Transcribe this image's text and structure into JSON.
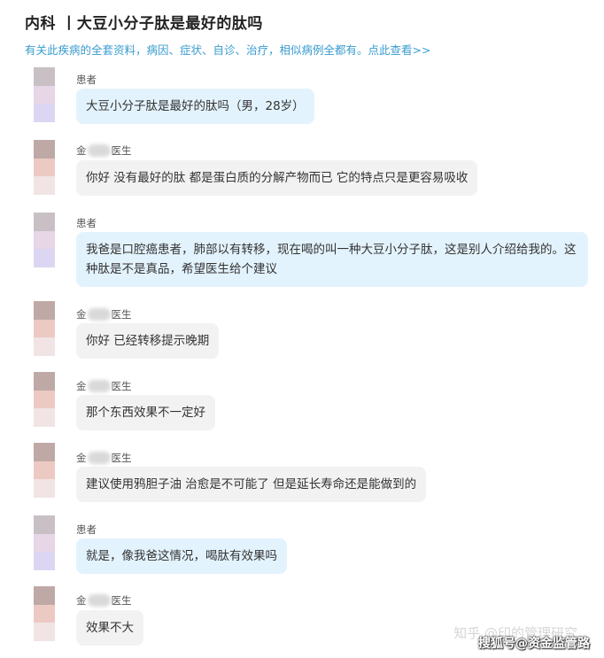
{
  "header": {
    "title": "内科 丨大豆小分子肽是最好的肽吗",
    "subtitle": "有关此疾病的全套资料，病因、症状、自诊、治疗，相似病例全都有。点此查看>>"
  },
  "messages": [
    {
      "role": "patient",
      "sender": "患者",
      "text": "大豆小分子肽是最好的肽吗（男，28岁）"
    },
    {
      "role": "doctor",
      "sender_prefix": "金",
      "sender_suffix": "医生",
      "text": "你好 没有最好的肽 都是蛋白质的分解产物而已 它的特点只是更容易吸收"
    },
    {
      "role": "patient",
      "sender": "患者",
      "text": "我爸是口腔癌患者，肺部以有转移，现在喝的叫一种大豆小分子肽，这是别人介绍给我的。这种肽是不是真品，希望医生给个建议"
    },
    {
      "role": "doctor",
      "sender_prefix": "金",
      "sender_suffix": "医生",
      "text": "你好 已经转移提示晚期"
    },
    {
      "role": "doctor",
      "sender_prefix": "金",
      "sender_suffix": "医生",
      "text": "那个东西效果不一定好"
    },
    {
      "role": "doctor",
      "sender_prefix": "金",
      "sender_suffix": "医生",
      "text": "建议使用鸦胆子油 治愈是不可能了 但是延长寿命还是能做到的"
    },
    {
      "role": "patient",
      "sender": "患者",
      "text": "就是，像我爸这情况，喝肽有效果吗"
    },
    {
      "role": "doctor",
      "sender_prefix": "金",
      "sender_suffix": "医生",
      "text": "效果不大"
    }
  ],
  "watermarks": {
    "zhihu": "知乎 @印的管理研究",
    "sohu": "搜狐号@资金监管路"
  },
  "colors": {
    "patient_bubble": "#e3f3fd",
    "doctor_bubble": "#f2f2f2",
    "link": "#3a9ccf"
  }
}
